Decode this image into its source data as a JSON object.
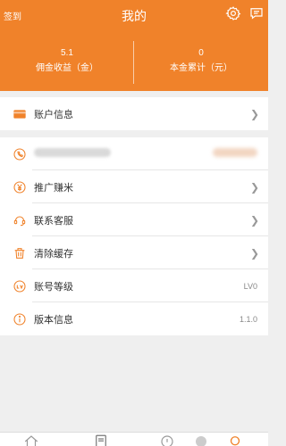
{
  "header": {
    "left_label": "签到",
    "title": "我的",
    "icons": [
      "settings-icon",
      "message-icon"
    ]
  },
  "stats": [
    {
      "value": "5.1",
      "label": "佣金收益（金）"
    },
    {
      "value": "0",
      "label": "本金累计（元）"
    }
  ],
  "menu": {
    "account_info": "账户信息",
    "promote": "推广赚米",
    "customer_service": "联系客服",
    "clear_cache": "清除缓存",
    "account_level": "账号等级",
    "account_level_value": "LV0",
    "version_info": "版本信息",
    "version_value": "1.1.0"
  },
  "colors": {
    "accent": "#f0822a"
  }
}
